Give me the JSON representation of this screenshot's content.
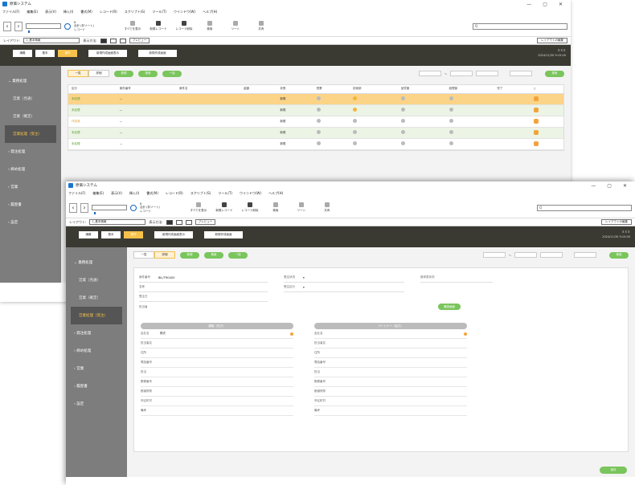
{
  "app": {
    "title": "原価システム",
    "window_controls": [
      "—",
      "▢",
      "✕"
    ]
  },
  "menu": [
    "ファイル(F)",
    "編集(E)",
    "表示(V)",
    "挿入(I)",
    "書式(M)",
    "レコード(R)",
    "スクリプト(S)",
    "ツール(T)",
    "ウインドウ(W)",
    "ヘルプ(H)"
  ],
  "toolbar": {
    "record_label_1": "8",
    "record_label_2": "合計 (非ソート)",
    "record_label_3": "レコード",
    "show_all": "すべてを表示",
    "new_record": "新規レコード",
    "delete_record": "レコード削除",
    "search": "検索",
    "sort": "ソート",
    "share": "共有",
    "search_placeholder": "Q"
  },
  "layoutbar": {
    "layout_label": "レイアウト:",
    "layout_value": "1_基本情報",
    "view_as_label": "表示方法:",
    "preview": "プレビュー",
    "edit_layout": "レイアウトの編集"
  },
  "darkbar": {
    "tabs": [
      "講義",
      "基本",
      "操作"
    ],
    "active_tab": 2,
    "wide_btn_1": "新規作成画面表示",
    "wide_btn_2": "新規作成画面",
    "user_name": "ＸＸＸ",
    "user_date": "2024/11/30 9:15:00"
  },
  "sidebar": {
    "items": [
      {
        "label": "業務処理",
        "arrow": "⌄"
      },
      {
        "label": "営業（見通）",
        "sub": true
      },
      {
        "label": "営業（確定）",
        "sub": true
      },
      {
        "label": "営業処理（受注）",
        "sub": true,
        "active": true
      },
      {
        "label": "発注処理",
        "arrow": "›"
      },
      {
        "label": "締め処理",
        "arrow": "›"
      },
      {
        "label": "営業",
        "arrow": "›"
      },
      {
        "label": "履歴書",
        "arrow": "›"
      },
      {
        "label": "設定",
        "arrow": "›"
      }
    ]
  },
  "list_view": {
    "seg": [
      "一覧",
      "詳細"
    ],
    "active_seg": 0,
    "buttons": [
      "新規",
      "検索",
      "一括"
    ],
    "search_btn": "検索",
    "columns": [
      "区分",
      "案件番号",
      "案件名",
      "金額",
      "状態",
      "営業",
      "技術部",
      "品質管",
      "経理部",
      "完了",
      ""
    ],
    "rows": [
      {
        "cls": "未処理",
        "num": "—",
        "state": "新規",
        "dots": [
          "g",
          "y",
          "g",
          "g"
        ],
        "style": "hl"
      },
      {
        "cls": "未処理",
        "num": "—",
        "state": "新規",
        "dots": [
          "g",
          "y",
          "g",
          "g"
        ],
        "style": "alt"
      },
      {
        "cls": "作成済",
        "num": "—",
        "state": "新規",
        "dots": [
          "g",
          "g",
          "g",
          "g"
        ],
        "style": ""
      },
      {
        "cls": "未処理",
        "num": "—",
        "state": "新規",
        "dots": [
          "g",
          "g",
          "g",
          "g"
        ],
        "style": "alt"
      },
      {
        "cls": "未処理",
        "num": "—",
        "state": "新規",
        "dots": [
          "g",
          "g",
          "g",
          "g"
        ],
        "style": ""
      }
    ]
  },
  "detail_view": {
    "seg": [
      "一覧",
      "詳細"
    ],
    "active_seg": 1,
    "buttons": [
      "新規",
      "検索",
      "一括"
    ],
    "search_btn": "検索",
    "top_fields": [
      {
        "label": "案件番号",
        "value": "BIL/TRG400"
      },
      {
        "label": "名称",
        "value": ""
      },
      {
        "label": "受注日",
        "value": ""
      },
      {
        "label": "担当者",
        "value": ""
      }
    ],
    "mid_fields": [
      {
        "label": "受注状況",
        "value": "▾"
      },
      {
        "label": "受注区分",
        "value": "▾"
      }
    ],
    "right_label": "請求書状況",
    "confirm_btn": "確認画面",
    "left_section": "顧客（先方）",
    "right_section": "パートナー（協力）",
    "left_fields": [
      "会社名",
      "担当者名",
      "住所",
      "電話番号",
      "担当",
      "郵便番号",
      "都道府県",
      "市区町村",
      "備考"
    ],
    "left_company": "株式",
    "right_fields": [
      "会社名",
      "担当者名",
      "住所",
      "電話番号",
      "担当",
      "郵便番号",
      "都道府県",
      "市区町村",
      "備考"
    ],
    "save_btn": "保存"
  },
  "colors": {
    "accent": "#f7c24a",
    "green": "#7ac55c",
    "dark": "#3a3a33",
    "sidebar": "#7d7d7d"
  }
}
